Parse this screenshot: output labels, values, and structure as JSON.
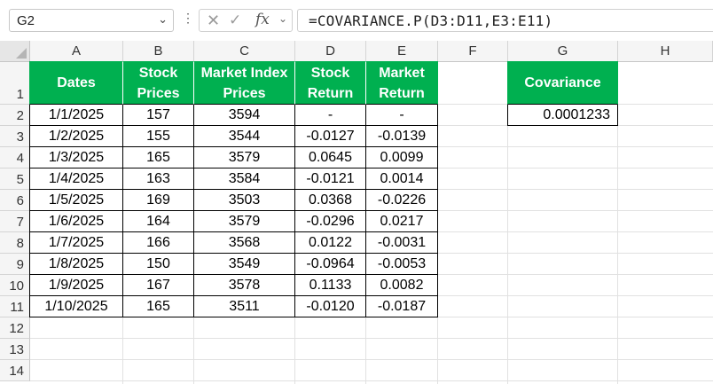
{
  "name_box": {
    "value": "G2"
  },
  "formula_bar": {
    "formula": "=COVARIANCE.P(D3:D11,E3:E11)",
    "fx_label": "fx"
  },
  "columns": [
    "A",
    "B",
    "C",
    "D",
    "E",
    "F",
    "G",
    "H"
  ],
  "rows": [
    "1",
    "2",
    "3",
    "4",
    "5",
    "6",
    "7",
    "8",
    "9",
    "10",
    "11",
    "12",
    "13",
    "14"
  ],
  "table": {
    "headers": {
      "dates": "Dates",
      "stock_prices": "Stock Prices",
      "market_index_prices": "Market Index Prices",
      "stock_return": "Stock Return",
      "market_return": "Market Return"
    },
    "rows": [
      [
        "1/1/2025",
        "157",
        "3594",
        "-",
        "-"
      ],
      [
        "1/2/2025",
        "155",
        "3544",
        "-0.0127",
        "-0.0139"
      ],
      [
        "1/3/2025",
        "165",
        "3579",
        "0.0645",
        "0.0099"
      ],
      [
        "1/4/2025",
        "163",
        "3584",
        "-0.0121",
        "0.0014"
      ],
      [
        "1/5/2025",
        "169",
        "3503",
        "0.0368",
        "-0.0226"
      ],
      [
        "1/6/2025",
        "164",
        "3579",
        "-0.0296",
        "0.0217"
      ],
      [
        "1/7/2025",
        "166",
        "3568",
        "0.0122",
        "-0.0031"
      ],
      [
        "1/8/2025",
        "150",
        "3549",
        "-0.0964",
        "-0.0053"
      ],
      [
        "1/9/2025",
        "167",
        "3578",
        "0.1133",
        "0.0082"
      ],
      [
        "1/10/2025",
        "165",
        "3511",
        "-0.0120",
        "-0.0187"
      ]
    ]
  },
  "covariance": {
    "header": "Covariance",
    "value": "0.0001233"
  },
  "colors": {
    "header_fill": "#00b050",
    "header_text": "#ffffff"
  }
}
